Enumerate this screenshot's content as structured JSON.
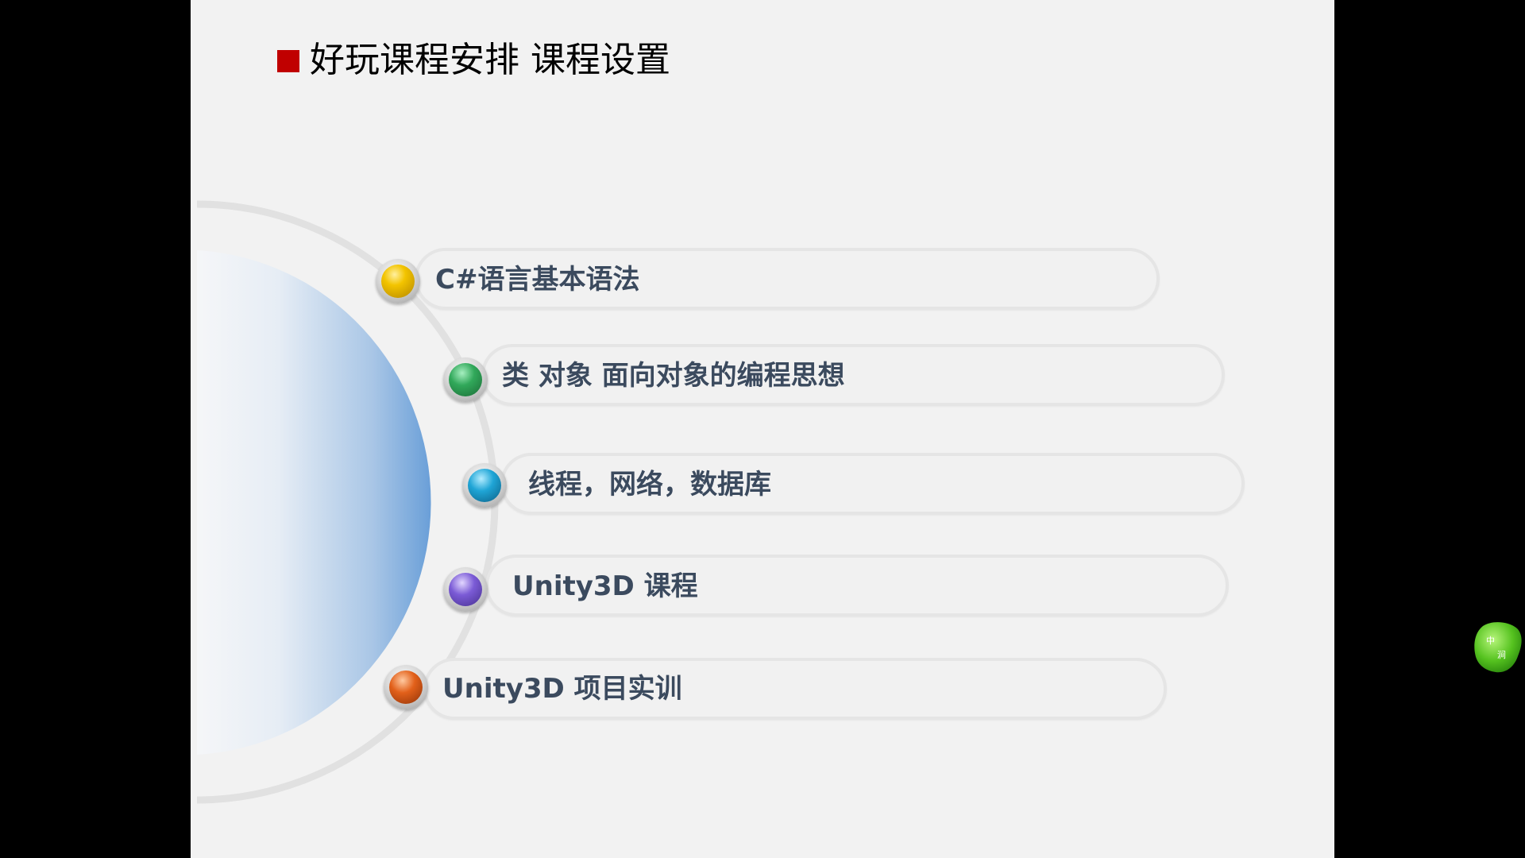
{
  "slide": {
    "title": "好玩课程安排 课程设置"
  },
  "items": [
    {
      "label": "C#语言基本语法",
      "color": "#f3c400"
    },
    {
      "label": "类 对象 面向对象的编程思想",
      "color": "#31a85a"
    },
    {
      "label": "线程，网络，数据库",
      "color": "#1fa5d6"
    },
    {
      "label": "Unity3D 课程",
      "color": "#7b5bd6"
    },
    {
      "label": "Unity3D 项目实训",
      "color": "#e2601a"
    }
  ],
  "colors": {
    "background": "#000000",
    "slide": "#f2f2f2",
    "title_marker": "#c00000",
    "label_text": "#3b4a5e",
    "disc_gradient_end": "#6a9fd8"
  },
  "watermark": {
    "chars": [
      "中",
      "涧"
    ]
  }
}
